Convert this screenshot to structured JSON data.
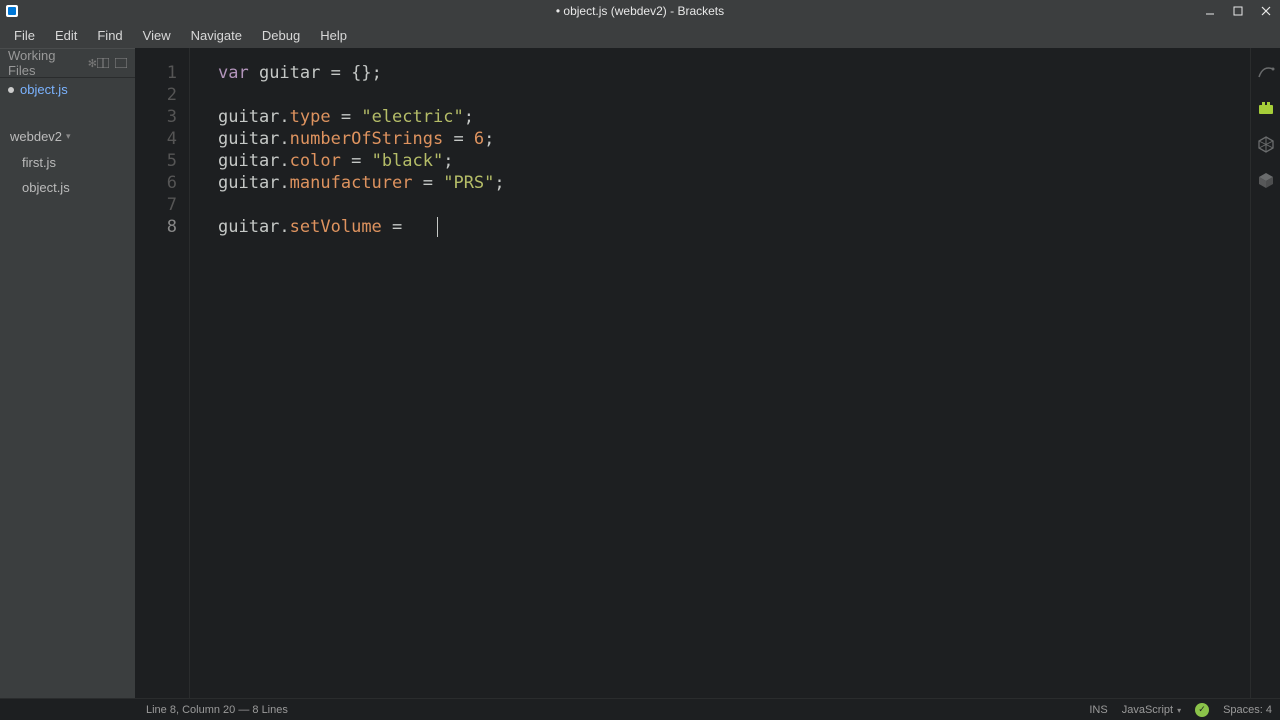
{
  "window": {
    "title": "• object.js (webdev2) - Brackets"
  },
  "menubar": {
    "items": [
      "File",
      "Edit",
      "Find",
      "View",
      "Navigate",
      "Debug",
      "Help"
    ]
  },
  "sidebar": {
    "working_files_label": "Working Files",
    "working_files": [
      {
        "name": "object.js",
        "active": true
      }
    ],
    "project_name": "webdev2",
    "project_files": [
      {
        "name": "first.js"
      },
      {
        "name": "object.js"
      }
    ]
  },
  "editor": {
    "gutter": [
      "1",
      "2",
      "3",
      "4",
      "5",
      "6",
      "7",
      "8"
    ],
    "lines": [
      [
        {
          "t": "var",
          "c": "kw"
        },
        {
          "t": " guitar ",
          "c": "ident"
        },
        {
          "t": "=",
          "c": "punct"
        },
        {
          "t": " ",
          "c": "ident"
        },
        {
          "t": "{};",
          "c": "punct"
        }
      ],
      [],
      [
        {
          "t": "guitar",
          "c": "ident"
        },
        {
          "t": ".",
          "c": "punct"
        },
        {
          "t": "type",
          "c": "prop"
        },
        {
          "t": " = ",
          "c": "punct"
        },
        {
          "t": "\"electric\"",
          "c": "str"
        },
        {
          "t": ";",
          "c": "punct"
        }
      ],
      [
        {
          "t": "guitar",
          "c": "ident"
        },
        {
          "t": ".",
          "c": "punct"
        },
        {
          "t": "numberOfStrings",
          "c": "prop"
        },
        {
          "t": " = ",
          "c": "punct"
        },
        {
          "t": "6",
          "c": "num"
        },
        {
          "t": ";",
          "c": "punct"
        }
      ],
      [
        {
          "t": "guitar",
          "c": "ident"
        },
        {
          "t": ".",
          "c": "punct"
        },
        {
          "t": "color",
          "c": "prop"
        },
        {
          "t": " = ",
          "c": "punct"
        },
        {
          "t": "\"black\"",
          "c": "str"
        },
        {
          "t": ";",
          "c": "punct"
        }
      ],
      [
        {
          "t": "guitar",
          "c": "ident"
        },
        {
          "t": ".",
          "c": "punct"
        },
        {
          "t": "manufacturer",
          "c": "prop"
        },
        {
          "t": " = ",
          "c": "punct"
        },
        {
          "t": "\"PRS\"",
          "c": "str"
        },
        {
          "t": ";",
          "c": "punct"
        }
      ],
      [],
      [
        {
          "t": "guitar",
          "c": "ident"
        },
        {
          "t": ".",
          "c": "punct"
        },
        {
          "t": "setVolume",
          "c": "prop"
        },
        {
          "t": " = ",
          "c": "punct"
        }
      ]
    ],
    "cursor_line_index": 7
  },
  "statusbar": {
    "position": "Line 8, Column 20 — 8 Lines",
    "ins": "INS",
    "language": "JavaScript",
    "spaces": "Spaces: 4"
  }
}
